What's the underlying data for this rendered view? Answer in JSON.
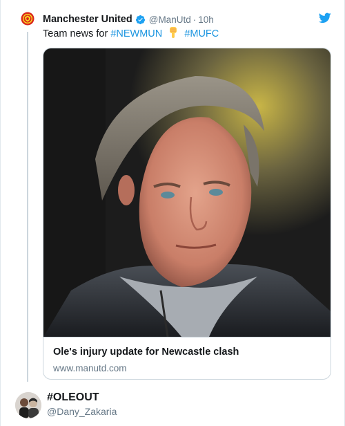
{
  "tweet": {
    "display_name": "Manchester United",
    "handle": "@ManUtd",
    "separator": "·",
    "time": "10h",
    "text_prefix": "Team news for",
    "hashtags": [
      "#NEWMUN",
      "#MUFC"
    ],
    "emoji": "👇",
    "card": {
      "title": "Ole's injury update for Newcastle clash",
      "url": "www.manutd.com"
    }
  },
  "reply": {
    "display_name": "#OLEOUT",
    "handle": "@Dany_Zakaria"
  },
  "colors": {
    "link": "#1b95e0",
    "twitter_blue": "#1da1f2",
    "muted_text": "#657786",
    "thread_line": "#ccd6dd",
    "united_red": "#da291c"
  },
  "icons": {
    "avatar": "manchester-united-crest-icon",
    "verified": "verified-badge-icon",
    "bird": "twitter-bird-icon",
    "emoji": "pointing-down-hand-icon"
  }
}
